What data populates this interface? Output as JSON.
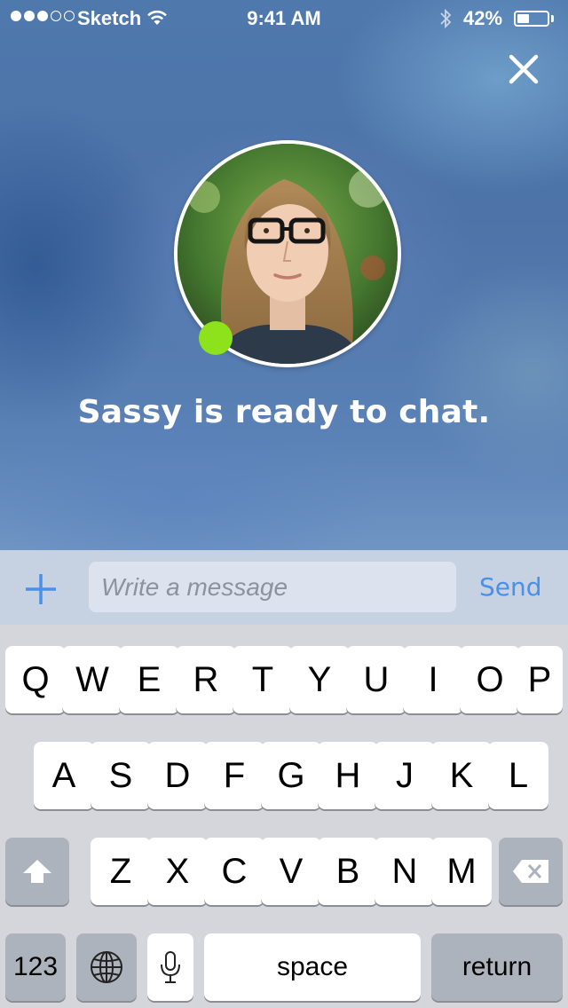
{
  "status_bar": {
    "carrier": "Sketch",
    "time": "9:41 AM",
    "battery_percent_label": "42%",
    "battery_level": 0.42,
    "signal_full": 3,
    "signal_total": 5
  },
  "chat_intro": {
    "status_text": "Sassy is ready to chat.",
    "online_color": "#8ee21b"
  },
  "composer": {
    "placeholder": "Write a message",
    "send_label": "Send"
  },
  "keyboard": {
    "row1": [
      "Q",
      "W",
      "E",
      "R",
      "T",
      "Y",
      "U",
      "I",
      "O",
      "P"
    ],
    "row2": [
      "A",
      "S",
      "D",
      "F",
      "G",
      "H",
      "J",
      "K",
      "L"
    ],
    "row3": [
      "Z",
      "X",
      "C",
      "V",
      "B",
      "N",
      "M"
    ],
    "numbers_label": "123",
    "space_label": "space",
    "return_label": "return"
  },
  "colors": {
    "accent": "#4a8fe8",
    "online": "#8ee21b"
  }
}
